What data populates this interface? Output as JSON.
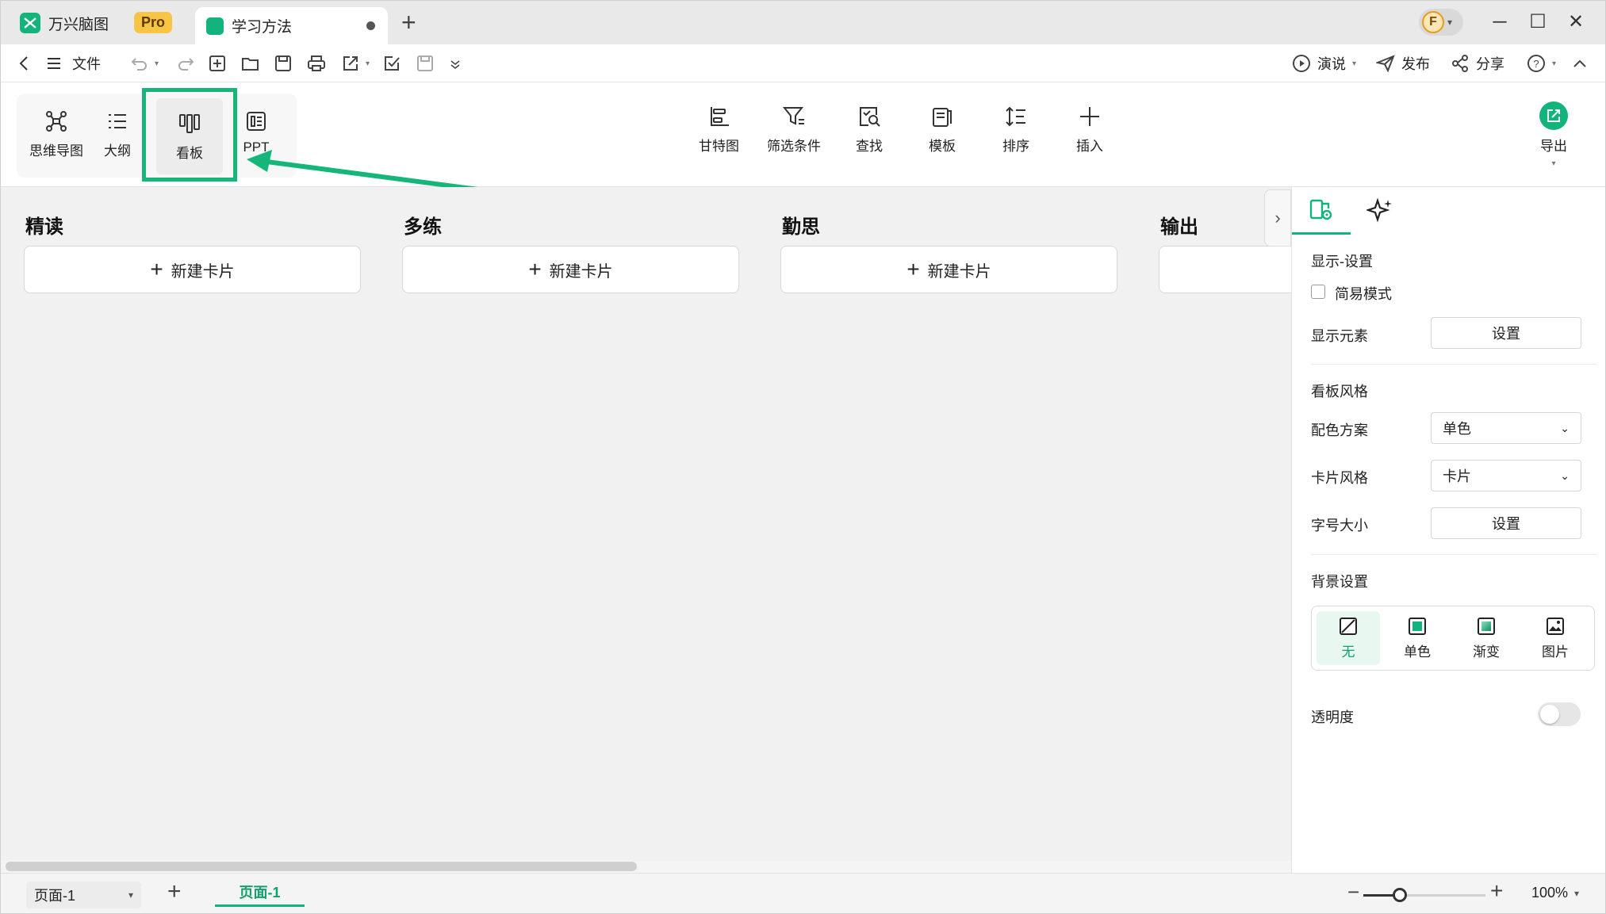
{
  "app": {
    "name": "万兴脑图",
    "badge": "Pro"
  },
  "tab": {
    "title": "学习方法"
  },
  "toolbar": {
    "file": "文件",
    "present": "演说",
    "publish": "发布",
    "share": "分享"
  },
  "views": [
    {
      "label": "思维导图",
      "icon": "mindmap-icon"
    },
    {
      "label": "大纲",
      "icon": "outline-icon"
    },
    {
      "label": "看板",
      "icon": "kanban-icon",
      "active": true
    },
    {
      "label": "PPT",
      "icon": "ppt-icon"
    }
  ],
  "ribbon": [
    {
      "label": "甘特图",
      "icon": "gantt-icon"
    },
    {
      "label": "筛选条件",
      "icon": "filter-icon"
    },
    {
      "label": "查找",
      "icon": "find-icon"
    },
    {
      "label": "模板",
      "icon": "template-icon"
    },
    {
      "label": "排序",
      "icon": "sort-icon"
    },
    {
      "label": "插入",
      "icon": "insert-icon"
    }
  ],
  "export": {
    "label": "导出"
  },
  "board": {
    "columns": [
      "精读",
      "多练",
      "勤思",
      "输出"
    ],
    "new_card": "新建卡片"
  },
  "panel": {
    "display_settings": "显示-设置",
    "simple_mode": "简易模式",
    "display_elements": "显示元素",
    "set": "设置",
    "board_style": "看板风格",
    "color_scheme": "配色方案",
    "color_scheme_value": "单色",
    "card_style": "卡片风格",
    "card_style_value": "卡片",
    "font_size": "字号大小",
    "bg_settings": "背景设置",
    "bg_options": [
      "无",
      "单色",
      "渐变",
      "图片"
    ],
    "opacity": "透明度"
  },
  "status": {
    "page_select": "页面-1",
    "page_tab": "页面-1",
    "zoom": "100%",
    "zoom_fraction": 0.3
  },
  "colors": {
    "accent": "#13b37c",
    "highlight": "#16b67b",
    "pro": "#f7c443"
  }
}
